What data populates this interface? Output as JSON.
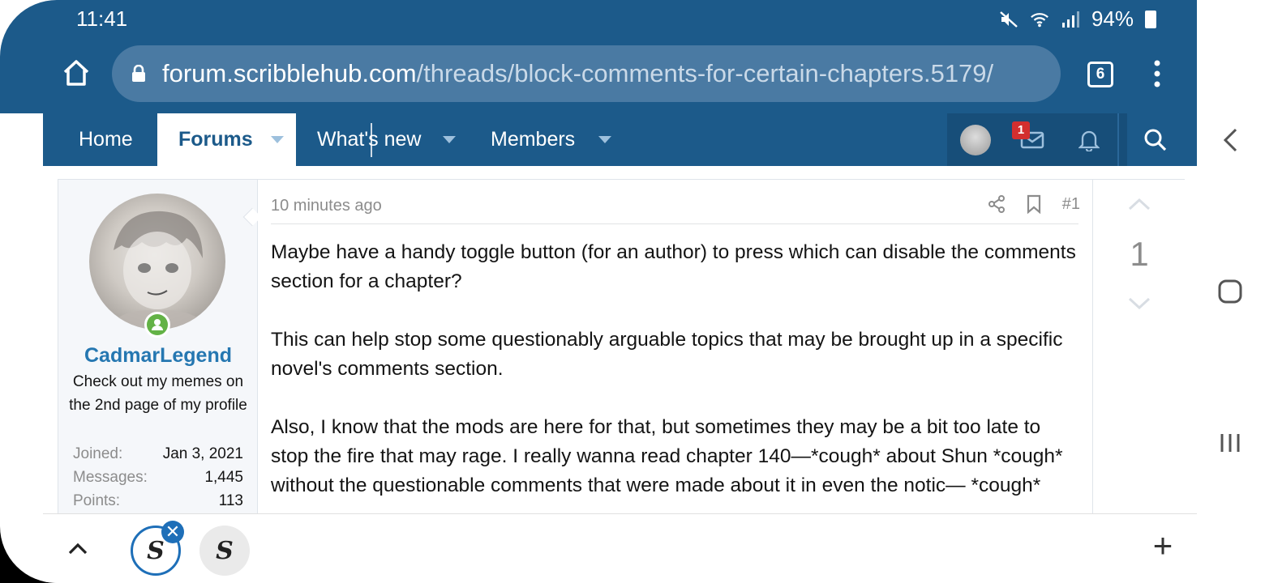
{
  "status_bar": {
    "time": "11:41",
    "battery": "94%"
  },
  "browser": {
    "url_host": "forum.scribblehub.com",
    "url_path": "/threads/block-comments-for-certain-chapters.5179/",
    "tab_count": "6"
  },
  "nav": {
    "home": "Home",
    "forums": "Forums",
    "whats_new": "What's new",
    "members": "Members",
    "mail_badge": "1"
  },
  "post": {
    "date": "10 minutes ago",
    "number": "#1",
    "vote_count": "1",
    "paragraphs": [
      "Maybe have a handy toggle button (for an author) to press which can disable the comments section for a chapter?",
      "This can help stop some questionably arguable topics that may be brought up in a specific novel's comments section.",
      "Also, I know that the mods are here for that, but sometimes they may be a bit too late to stop the fire that may rage. I really wanna read chapter 140—*cough* about Shun *cough* without the questionable comments that were made about it in even the notic— *cough*"
    ]
  },
  "user": {
    "name": "CadmarLegend",
    "title": "Check out my memes on the 2nd page of my profile",
    "stats": [
      {
        "label": "Joined:",
        "value": "Jan 3, 2021"
      },
      {
        "label": "Messages:",
        "value": "1,445"
      },
      {
        "label": "Points:",
        "value": "113"
      }
    ]
  },
  "tab_strip": {
    "close_symbol": "✕",
    "favicon_letter": "S",
    "new_tab": "+"
  }
}
